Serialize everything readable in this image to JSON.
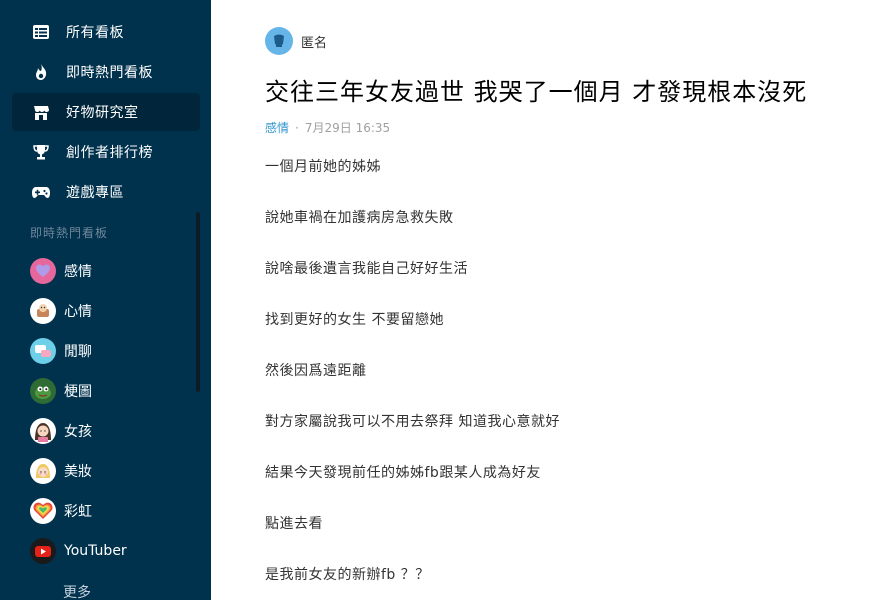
{
  "sidebar": {
    "nav": [
      {
        "label": "所有看板",
        "icon": "board-list-icon"
      },
      {
        "label": "即時熱門看板",
        "icon": "flame-icon"
      },
      {
        "label": "好物研究室",
        "icon": "store-icon"
      },
      {
        "label": "創作者排行榜",
        "icon": "trophy-icon"
      },
      {
        "label": "遊戲專區",
        "icon": "gamepad-icon"
      }
    ],
    "active_index": 2,
    "section_title": "即時熱門看板",
    "forums": [
      {
        "label": "感情",
        "icon": "heart-icon"
      },
      {
        "label": "心情",
        "icon": "mood-icon"
      },
      {
        "label": "閒聊",
        "icon": "chat-icon"
      },
      {
        "label": "梗圖",
        "icon": "meme-frog-icon"
      },
      {
        "label": "女孩",
        "icon": "girl-icon"
      },
      {
        "label": "美妝",
        "icon": "makeup-icon"
      },
      {
        "label": "彩虹",
        "icon": "rainbow-icon"
      },
      {
        "label": "YouTuber",
        "icon": "youtube-icon"
      }
    ],
    "more_label": "更多"
  },
  "post": {
    "author": "匿名",
    "title": "交往三年女友過世 我哭了一個月 才發現根本沒死",
    "board": "感情",
    "separator": "·",
    "date": "7月29日 16:35",
    "lines": [
      "一個月前她的姊姊",
      "說她車禍在加護病房急救失敗",
      "說啥最後遺言我能自己好好生活",
      "找到更好的女生 不要留戀她",
      "然後因爲遠距離",
      "對方家屬說我可以不用去祭拜 知道我心意就好",
      "結果今天發現前任的姊姊fb跟某人成為好友",
      "點進去看",
      "是我前女友的新辦fb ？？"
    ]
  },
  "colors": {
    "sidebar_bg": "#00324e",
    "sidebar_active": "#01253a",
    "board_link": "#3397cf",
    "avatar": "#65b5e8"
  }
}
